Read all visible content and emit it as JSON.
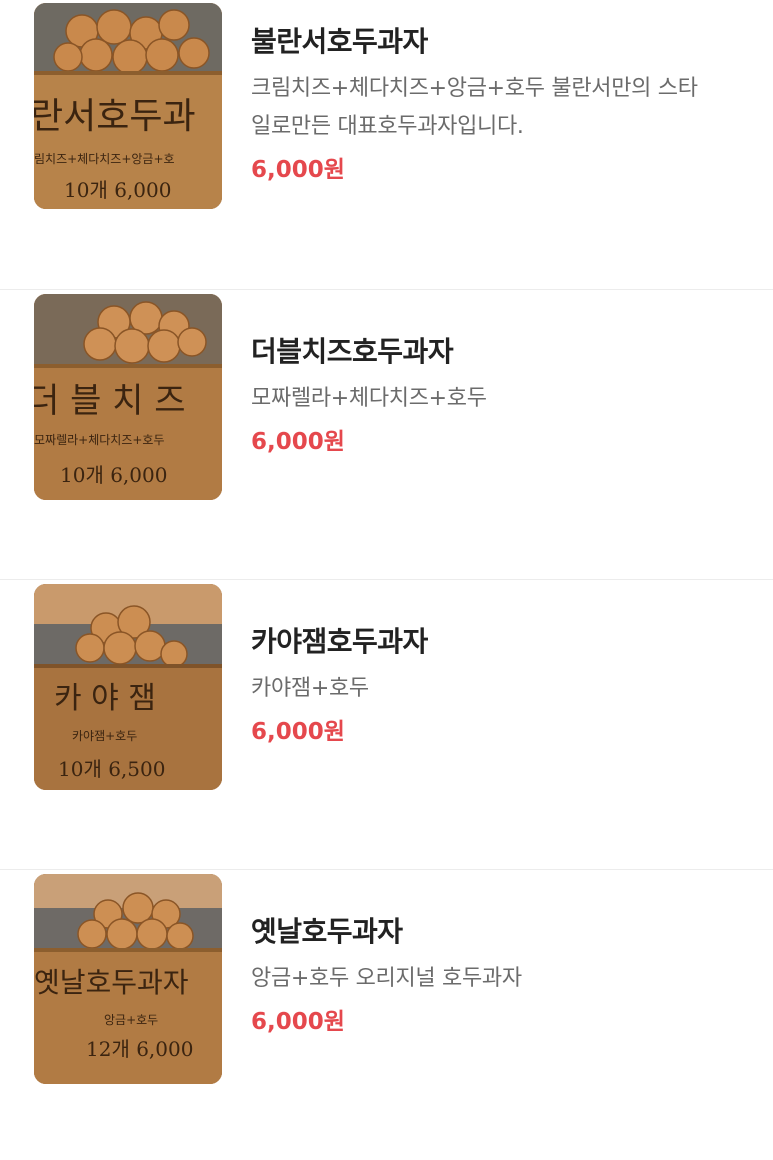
{
  "menu": {
    "items": [
      {
        "name": "불란서호두과자",
        "description": "크림치즈+체다치즈+앙금+호두 불란서만의 스타일로만든 대표호두과자입니다.",
        "desc_line1": "크림치즈+체다치즈+앙금+호두 불란서만의 스타",
        "desc_line2": "일로만든 대표호두과자입니다.",
        "price": "6,000원",
        "photo": {
          "sign_title": "란서호두과",
          "sign_sub": "림치즈+체다치즈+앙금+호",
          "sign_price": "10개 6,000"
        }
      },
      {
        "name": "더블치즈호두과자",
        "description": "모짜렐라+체다치즈+호두",
        "price": "6,000원",
        "photo": {
          "sign_title": "더 블 치 즈",
          "sign_sub": "모짜렐라+체다치즈+호두",
          "sign_price": "10개 6,000"
        }
      },
      {
        "name": "카야잼호두과자",
        "description": "카야잼+호두",
        "price": "6,000원",
        "photo": {
          "sign_title": "카 야 잼",
          "sign_sub": "카야잼+호두",
          "sign_price": "10개 6,500"
        }
      },
      {
        "name": "옛날호두과자",
        "description": "앙금+호두 오리지널 호두과자",
        "price": "6,000원",
        "photo": {
          "sign_title": "옛날호두과자",
          "sign_sub": "앙금+호두",
          "sign_price": "12개 6,000"
        }
      }
    ]
  },
  "colors": {
    "price": "#e5484d",
    "title": "#222222",
    "description": "#6b6b6b",
    "divider": "#ececec",
    "wood": "#b07c45"
  }
}
